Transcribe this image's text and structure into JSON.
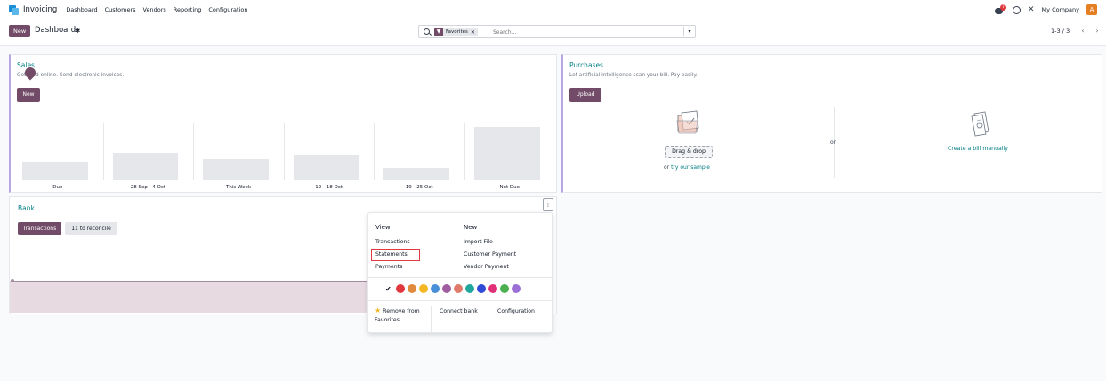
{
  "navbar": {
    "app_name": "Invoicing",
    "items": [
      "Dashboard",
      "Customers",
      "Vendors",
      "Reporting",
      "Configuration"
    ],
    "chat_badge": "7",
    "company": "My Company",
    "avatar_letter": "A"
  },
  "control": {
    "new_label": "New",
    "title": "Dashboard",
    "search": {
      "facet_label": "Favorites",
      "placeholder": "Search..."
    },
    "pager": "1-3 / 3"
  },
  "sales": {
    "title": "Sales",
    "subtitle": "Get paid online. Send electronic invoices.",
    "button": "New",
    "chart_data": {
      "type": "bar",
      "categories": [
        "Due",
        "28 Sep - 4 Oct",
        "This Week",
        "12 - 18 Oct",
        "19 - 25 Oct",
        "Not Due"
      ],
      "values": [
        19,
        28,
        22,
        25,
        13,
        54
      ]
    }
  },
  "purchases": {
    "title": "Purchases",
    "subtitle": "Let artificial intelligence scan your bill. Pay easily.",
    "button": "Upload",
    "drag_label": "Drag & drop",
    "or_text": "or",
    "sample_link": "try our sample",
    "middle_or": "or",
    "create_label": "Create a bill manually"
  },
  "bank": {
    "title": "Bank",
    "transactions_btn": "Transactions",
    "reconcile_btn": "11 to reconcile"
  },
  "dropdown": {
    "view_header": "View",
    "new_header": "New",
    "view_items": [
      "Transactions",
      "Statements",
      "Payments"
    ],
    "new_items": [
      "Import File",
      "Customer Payment",
      "Vendor Payment"
    ],
    "colors": [
      "#e0383e",
      "#e08a3e",
      "#f3b724",
      "#4a90d9",
      "#a05ea0",
      "#e07a6a",
      "#21a69e",
      "#2f4ad6",
      "#e0307a",
      "#4caf50",
      "#9b6fd6"
    ],
    "remove_line1": "Remove from",
    "remove_line2": "Favorites",
    "connect_bank": "Connect bank",
    "configuration": "Configuration"
  },
  "icons": {
    "app": "invoicing-logo",
    "chat": "chat-icon",
    "clock": "clock-icon",
    "tools": "tools-icon",
    "search": "search-icon",
    "filter": "filter-icon",
    "gear": "gear-icon",
    "kebab": "kebab-menu-icon"
  }
}
